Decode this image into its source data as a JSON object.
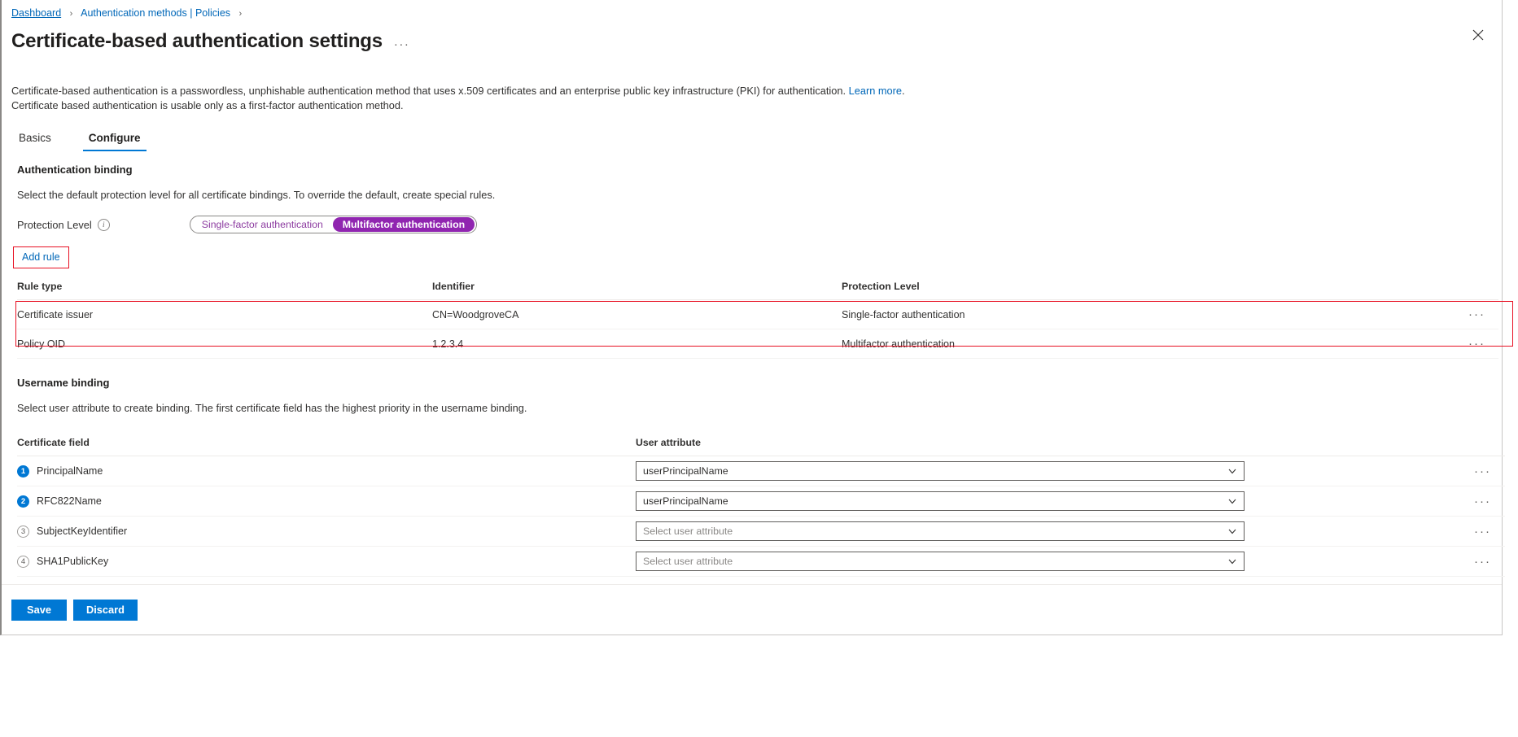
{
  "breadcrumb": {
    "items": [
      {
        "label": "Dashboard",
        "underline": true
      },
      {
        "label": "Authentication methods | Policies",
        "underline": false
      }
    ],
    "separator": "›"
  },
  "header": {
    "title": "Certificate-based authentication settings",
    "ellipsis": "···",
    "close_icon": "close-icon"
  },
  "description": {
    "line1_before_link": "Certificate-based authentication is a passwordless, unphishable authentication method that uses x.509 certificates and an enterprise public key infrastructure (PKI) for authentication. ",
    "learn_more": "Learn more",
    "line1_after_link": ".",
    "line2": "Certificate based authentication is usable only as a first-factor authentication method."
  },
  "tabs": [
    {
      "label": "Basics",
      "active": false
    },
    {
      "label": "Configure",
      "active": true
    }
  ],
  "authentication_binding": {
    "heading": "Authentication binding",
    "subtext": "Select the default protection level for all certificate bindings. To override the default, create special rules.",
    "protection_level_label": "Protection Level",
    "info_icon": "info-icon",
    "toggle": {
      "options": [
        {
          "label": "Single-factor authentication",
          "selected": false
        },
        {
          "label": "Multifactor authentication",
          "selected": true
        }
      ]
    },
    "add_rule_label": "Add rule",
    "table": {
      "columns": [
        "Rule type",
        "Identifier",
        "Protection Level"
      ],
      "rows": [
        {
          "rule_type": "Certificate issuer",
          "identifier": "CN=WoodgroveCA",
          "protection_level": "Single-factor authentication",
          "menu": "···"
        },
        {
          "rule_type": "Policy OID",
          "identifier": "1.2.3.4",
          "protection_level": "Multifactor authentication",
          "menu": "···"
        }
      ]
    }
  },
  "username_binding": {
    "heading": "Username binding",
    "subtext": "Select user attribute to create binding. The first certificate field has the highest priority in the username binding.",
    "columns": [
      "Certificate field",
      "User attribute"
    ],
    "rows": [
      {
        "index": "1",
        "badge_filled": true,
        "certificate_field": "PrincipalName",
        "user_attribute_value": "userPrincipalName",
        "is_placeholder": false,
        "menu": "···"
      },
      {
        "index": "2",
        "badge_filled": true,
        "certificate_field": "RFC822Name",
        "user_attribute_value": "userPrincipalName",
        "is_placeholder": false,
        "menu": "···"
      },
      {
        "index": "3",
        "badge_filled": false,
        "certificate_field": "SubjectKeyIdentifier",
        "user_attribute_value": "Select user attribute",
        "is_placeholder": true,
        "menu": "···"
      },
      {
        "index": "4",
        "badge_filled": false,
        "certificate_field": "SHA1PublicKey",
        "user_attribute_value": "Select user attribute",
        "is_placeholder": true,
        "menu": "···"
      }
    ]
  },
  "footer": {
    "save_label": "Save",
    "discard_label": "Discard"
  },
  "colors": {
    "accent_blue": "#0078d4",
    "link_blue": "#0067b8",
    "highlight_red": "#e81123",
    "mfa_purple": "#9025b0"
  }
}
